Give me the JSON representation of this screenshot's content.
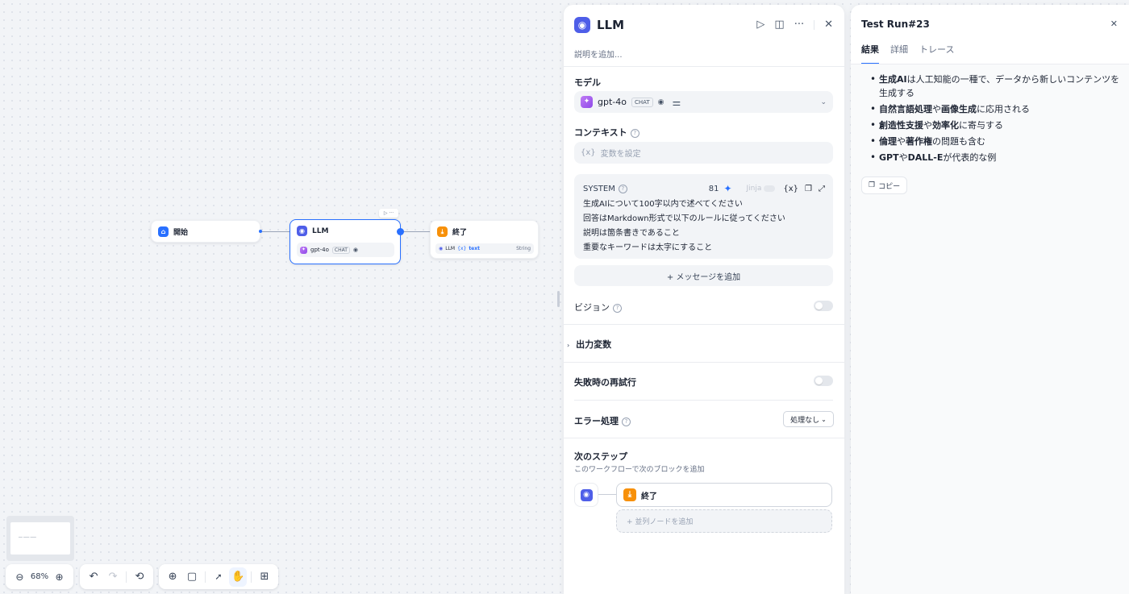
{
  "canvas": {
    "start_node": {
      "label": "開始"
    },
    "llm_node": {
      "label": "LLM",
      "model": "gpt-4o",
      "badge": "CHAT",
      "mini_actions": "▷ ···"
    },
    "end_node": {
      "label": "終了",
      "var_source": "LLM",
      "var_name": "text",
      "var_type": "String"
    },
    "minimap": {
      "text": "━━ ━━━ ━━━"
    }
  },
  "toolbar": {
    "zoom": "68%"
  },
  "node_panel": {
    "title": "LLM",
    "description_placeholder": "説明を追加...",
    "model": {
      "label": "モデル",
      "name": "gpt-4o",
      "badge": "CHAT"
    },
    "context": {
      "label": "コンテキスト",
      "placeholder": "変数を設定",
      "var_glyph": "{x}"
    },
    "system": {
      "label": "SYSTEM",
      "count": "81",
      "jinja": "Jinja",
      "lines": [
        "生成AIについて100字以内で述べてください",
        "回答はMarkdown形式で以下のルールに従ってください",
        "説明は箇条書きであること",
        "重要なキーワードは太字にすること"
      ]
    },
    "add_message": "+ メッセージを追加",
    "vision": {
      "label": "ビジョン"
    },
    "output_vars": {
      "label": "出力変数"
    },
    "retry": {
      "label": "失敗時の再試行"
    },
    "error": {
      "label": "エラー処理",
      "value": "処理なし"
    },
    "next_step": {
      "label": "次のステップ",
      "description": "このワークフローで次のブロックを追加",
      "end_label": "終了",
      "add_parallel": "+ 並列ノードを追加"
    }
  },
  "result_panel": {
    "title": "Test Run#23",
    "tabs": [
      "結果",
      "詳細",
      "トレース"
    ],
    "items": [
      {
        "pre": "",
        "b1": "生成AI",
        "mid": "は人工知能の一種で、データから新しいコンテンツを生成する",
        "b2": "",
        "post": ""
      },
      {
        "pre": "",
        "b1": "自然言語処理",
        "mid": "や",
        "b2": "画像生成",
        "post": "に応用される"
      },
      {
        "pre": "",
        "b1": "創造性支援",
        "mid": "や",
        "b2": "効率化",
        "post": "に寄与する"
      },
      {
        "pre": "",
        "b1": "倫理",
        "mid": "や",
        "b2": "著作権",
        "post": "の問題も含む"
      },
      {
        "pre": "",
        "b1": "GPT",
        "mid": "や",
        "b2": "DALL-E",
        "post": "が代表的な例"
      }
    ],
    "copy_label": "コピー"
  }
}
